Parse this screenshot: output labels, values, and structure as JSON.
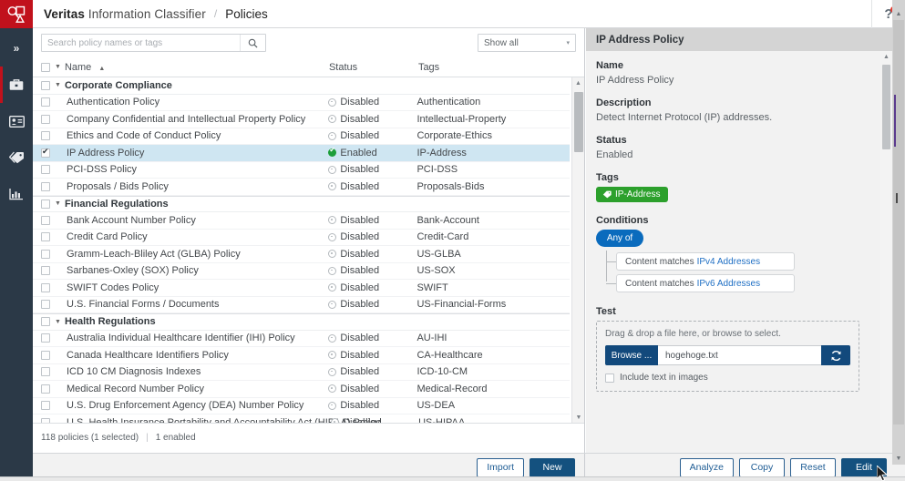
{
  "header": {
    "brand_bold": "Veritas",
    "brand_rest": "Information Classifier",
    "crumb_separator": "/",
    "page": "Policies",
    "help_icon": "question-mark-icon"
  },
  "rail": {
    "items": [
      {
        "icon": "chevron-double-right-icon",
        "name": "expand-menu"
      },
      {
        "icon": "briefcase-icon",
        "name": "policies"
      },
      {
        "icon": "id-card-icon",
        "name": "identities"
      },
      {
        "icon": "tag-icon",
        "name": "tags"
      },
      {
        "icon": "bar-chart-icon",
        "name": "reports"
      }
    ]
  },
  "toolbar": {
    "search_placeholder": "Search policy names or tags",
    "search_value": "",
    "search_icon": "magnifier-icon",
    "filter_value": "Show all",
    "filter_caret": "▾"
  },
  "columns": {
    "name": "Name",
    "status": "Status",
    "tags": "Tags",
    "sort_indicator": "▲"
  },
  "groups": [
    {
      "label": "Corporate Compliance",
      "rows": [
        {
          "name": "Authentication Policy",
          "status": "Disabled",
          "tags": "Authentication",
          "enabled": false,
          "selected": false
        },
        {
          "name": "Company Confidential and Intellectual Property Policy",
          "status": "Disabled",
          "tags": "Intellectual-Property",
          "enabled": false,
          "selected": false
        },
        {
          "name": "Ethics and Code of Conduct Policy",
          "status": "Disabled",
          "tags": "Corporate-Ethics",
          "enabled": false,
          "selected": false
        },
        {
          "name": "IP Address Policy",
          "status": "Enabled",
          "tags": "IP-Address",
          "enabled": true,
          "selected": true
        },
        {
          "name": "PCI-DSS Policy",
          "status": "Disabled",
          "tags": "PCI-DSS",
          "enabled": false,
          "selected": false
        },
        {
          "name": "Proposals / Bids Policy",
          "status": "Disabled",
          "tags": "Proposals-Bids",
          "enabled": false,
          "selected": false
        }
      ]
    },
    {
      "label": "Financial Regulations",
      "rows": [
        {
          "name": "Bank Account Number Policy",
          "status": "Disabled",
          "tags": "Bank-Account",
          "enabled": false,
          "selected": false
        },
        {
          "name": "Credit Card Policy",
          "status": "Disabled",
          "tags": "Credit-Card",
          "enabled": false,
          "selected": false
        },
        {
          "name": "Gramm-Leach-Bliley Act (GLBA) Policy",
          "status": "Disabled",
          "tags": "US-GLBA",
          "enabled": false,
          "selected": false
        },
        {
          "name": "Sarbanes-Oxley (SOX) Policy",
          "status": "Disabled",
          "tags": "US-SOX",
          "enabled": false,
          "selected": false
        },
        {
          "name": "SWIFT Codes Policy",
          "status": "Disabled",
          "tags": "SWIFT",
          "enabled": false,
          "selected": false
        },
        {
          "name": "U.S. Financial Forms / Documents",
          "status": "Disabled",
          "tags": "US-Financial-Forms",
          "enabled": false,
          "selected": false
        }
      ]
    },
    {
      "label": "Health Regulations",
      "rows": [
        {
          "name": "Australia Individual Healthcare Identifier (IHI) Policy",
          "status": "Disabled",
          "tags": "AU-IHI",
          "enabled": false,
          "selected": false
        },
        {
          "name": "Canada Healthcare Identifiers Policy",
          "status": "Disabled",
          "tags": "CA-Healthcare",
          "enabled": false,
          "selected": false
        },
        {
          "name": "ICD 10 CM Diagnosis Indexes",
          "status": "Disabled",
          "tags": "ICD-10-CM",
          "enabled": false,
          "selected": false
        },
        {
          "name": "Medical Record Number Policy",
          "status": "Disabled",
          "tags": "Medical-Record",
          "enabled": false,
          "selected": false
        },
        {
          "name": "U.S. Drug Enforcement Agency (DEA) Number Policy",
          "status": "Disabled",
          "tags": "US-DEA",
          "enabled": false,
          "selected": false
        },
        {
          "name": "U.S. Health Insurance Portability and Accountability Act (HIPAA) Policy",
          "status": "Disabled",
          "tags": "US-HIPAA",
          "enabled": false,
          "selected": false
        }
      ]
    }
  ],
  "list_status": {
    "count_text": "118 policies (1 selected)",
    "divider": "|",
    "enabled_text": "1 enabled"
  },
  "detail": {
    "title": "IP Address Policy",
    "name_label": "Name",
    "name_value": "IP Address Policy",
    "description_label": "Description",
    "description_value": "Detect Internet Protocol (IP) addresses.",
    "status_label": "Status",
    "status_value": "Enabled",
    "tags_label": "Tags",
    "tag_icon": "tag-icon",
    "tags": [
      "IP-Address"
    ],
    "conditions_label": "Conditions",
    "operator": "Any of",
    "conditions": [
      {
        "prefix": "Content matches",
        "link": "IPv4 Addresses"
      },
      {
        "prefix": "Content matches",
        "link": "IPv6 Addresses"
      }
    ],
    "test_label": "Test",
    "dnd_text": "Drag & drop a file here, or browse to select.",
    "browse_label": "Browse ...",
    "file_name": "hogehoge.txt",
    "refresh_icon": "refresh-icon",
    "include_images_label": "Include text in images",
    "include_images_checked": false
  },
  "footer": {
    "left_buttons": [
      {
        "label": "Import",
        "primary": false,
        "name": "import-button"
      },
      {
        "label": "New",
        "primary": true,
        "name": "new-button"
      }
    ],
    "right_buttons": [
      {
        "label": "Analyze",
        "primary": false,
        "name": "analyze-button"
      },
      {
        "label": "Copy",
        "primary": false,
        "name": "copy-button"
      },
      {
        "label": "Reset",
        "primary": false,
        "name": "reset-button"
      },
      {
        "label": "Edit",
        "primary": true,
        "name": "edit-button"
      }
    ]
  },
  "colors": {
    "brand_red": "#c1111c",
    "rail_dark": "#2b3947",
    "accent_blue": "#0a6bbd",
    "primary_button": "#14517f",
    "enabled_green": "#1c9e3a",
    "tag_green": "#2ca02c",
    "selection_blue": "#cfe6f2",
    "link_blue": "#1f6fc4"
  }
}
